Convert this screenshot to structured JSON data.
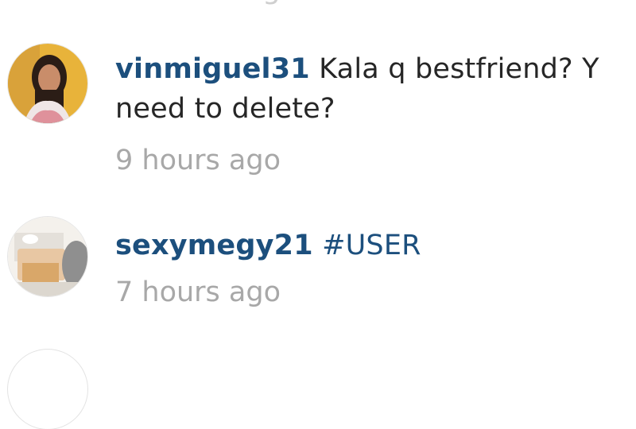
{
  "comments": [
    {
      "username": "vinmiguel31",
      "text": "Kala q bestfriend? Y need to delete?",
      "time": "9 hours ago",
      "avatar_icon": "user-photo-woman"
    },
    {
      "username": "sexymegy21",
      "text": "#USER",
      "time": "7 hours ago",
      "avatar_icon": "user-photo-food"
    }
  ],
  "colors": {
    "username": "#1c4f7d",
    "body_text": "#262626",
    "timestamp": "#a8a8a8"
  }
}
